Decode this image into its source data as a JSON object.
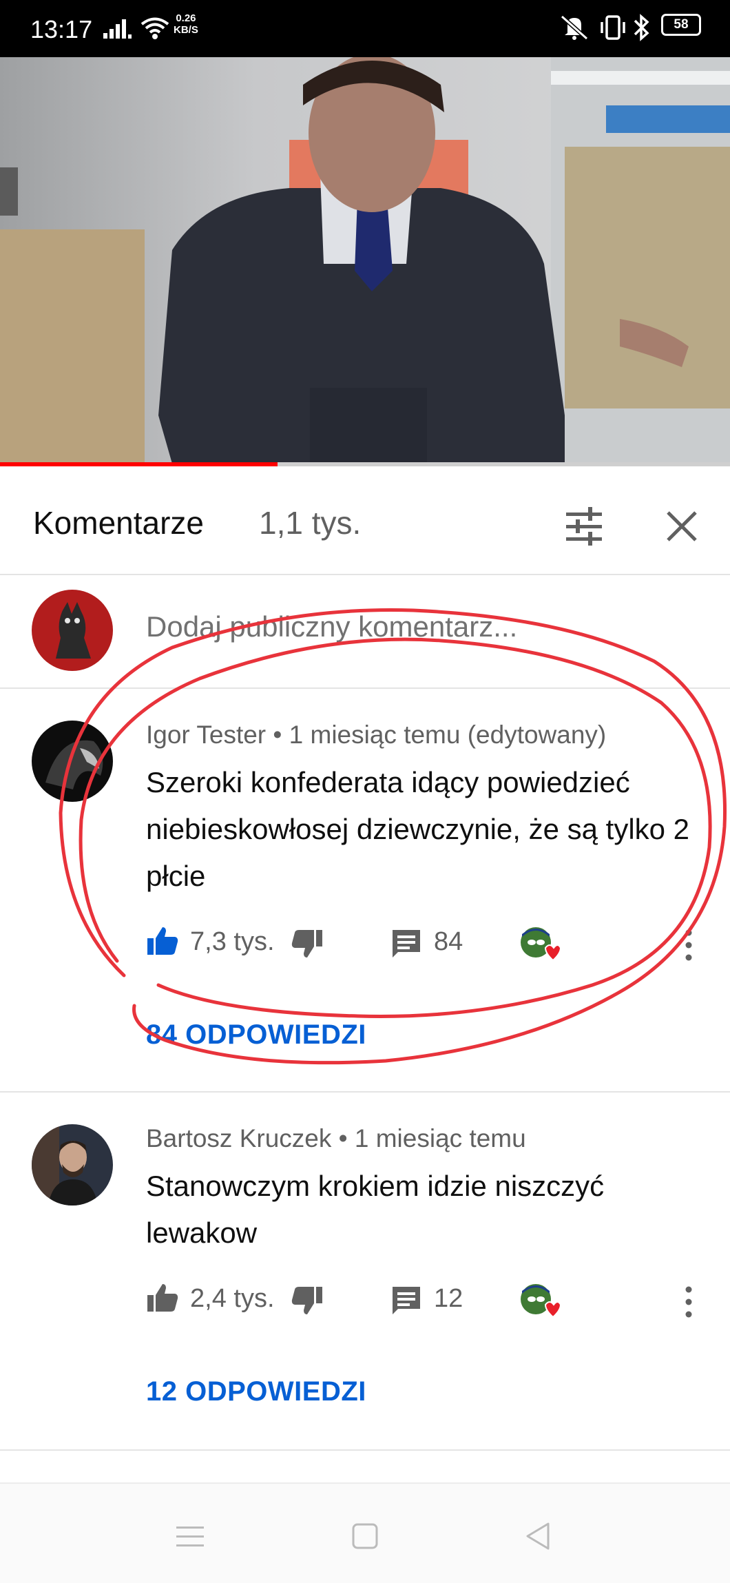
{
  "status_bar": {
    "time": "13:17",
    "net_speed_value": "0.26",
    "net_speed_unit": "KB/S",
    "battery": "58",
    "icons": [
      "signal-icon",
      "wifi-icon",
      "mute-icon",
      "vibrate-icon",
      "bluetooth-icon",
      "battery-icon"
    ]
  },
  "video": {
    "progress_fraction": 0.38,
    "progress_color": "#ff0000"
  },
  "comments_panel": {
    "title": "Komentarze",
    "count": "1,1 tys.",
    "add_comment_placeholder": "Dodaj publiczny komentarz...",
    "comments": [
      {
        "author": "Igor Tester",
        "meta": "Igor Tester • 1 miesiąc temu (edytowany)",
        "text": "Szeroki konfederata idący powiedzieć niebieskowłosej dziewczynie, że są tylko 2 płcie",
        "likes": "7,3 tys.",
        "liked": true,
        "replies_count": "84",
        "replies_link": "84 ODPOWIEDZI"
      },
      {
        "author": "Bartosz Kruczek",
        "meta": "Bartosz Kruczek • 1 miesiąc temu",
        "text": "Stanowczym krokiem idzie niszczyć lewakow",
        "likes": "2,4 tys.",
        "liked": false,
        "replies_count": "12",
        "replies_link": "12 ODPOWIEDZI"
      }
    ]
  },
  "colors": {
    "accent_blue": "#065fd4",
    "annotation_red": "#e8333b",
    "text_secondary": "#606060"
  }
}
